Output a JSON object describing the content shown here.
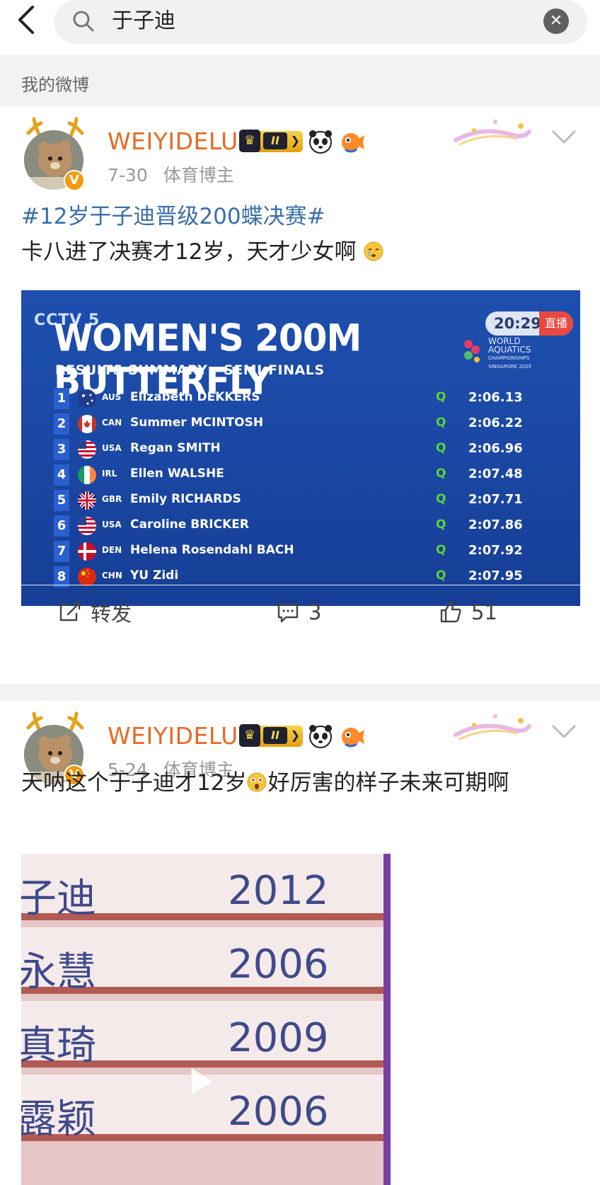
{
  "search": {
    "query": "于子迪"
  },
  "section": {
    "title": "我的微博"
  },
  "posts": [
    {
      "username": "WEIYIDELU",
      "date": "7-30",
      "category": "体育博主",
      "avatar_tag": "出现",
      "topic": "#12岁于子迪晋级200蝶决赛#",
      "text": "卡八进了决赛才12岁，天才少女啊",
      "image": {
        "brand": "CCTV 5",
        "title": "WOMEN'S 200M BUTTERFLY",
        "subtitle": "RESULTS SUMMARY - SEMI-FINALS",
        "clock": "20:29:48",
        "live_label": "直播",
        "event_logo": [
          "WORLD",
          "AQUATICS",
          "CHAMPIONSHIPS",
          "SINGAPORE 2025"
        ],
        "results": [
          {
            "rank": "1",
            "country": "AUS",
            "name": "Elizabeth DEKKERS",
            "q": "Q",
            "time": "2:06.13"
          },
          {
            "rank": "2",
            "country": "CAN",
            "name": "Summer MCINTOSH",
            "q": "Q",
            "time": "2:06.22"
          },
          {
            "rank": "3",
            "country": "USA",
            "name": "Regan SMITH",
            "q": "Q",
            "time": "2:06.96"
          },
          {
            "rank": "4",
            "country": "IRL",
            "name": "Ellen WALSHE",
            "q": "Q",
            "time": "2:07.48"
          },
          {
            "rank": "5",
            "country": "GBR",
            "name": "Emily RICHARDS",
            "q": "Q",
            "time": "2:07.71"
          },
          {
            "rank": "6",
            "country": "USA",
            "name": "Caroline BRICKER",
            "q": "Q",
            "time": "2:07.86"
          },
          {
            "rank": "7",
            "country": "DEN",
            "name": "Helena Rosendahl BACH",
            "q": "Q",
            "time": "2:07.92"
          },
          {
            "rank": "8",
            "country": "CHN",
            "name": "YU Zidi",
            "q": "Q",
            "time": "2:07.95"
          }
        ]
      },
      "actions": {
        "repost": "转发",
        "comments": "3",
        "likes": "51"
      }
    },
    {
      "username": "WEIYIDELU",
      "date": "5-24",
      "category": "体育博主",
      "avatar_tag": "出现",
      "text_a": "天呐这个于子迪才12岁",
      "text_b": "好厉害的样子未来可期啊",
      "image": {
        "rows": [
          {
            "name": "子迪",
            "year": "2012"
          },
          {
            "name": "永慧",
            "year": "2006"
          },
          {
            "name": "真琦",
            "year": "2009"
          },
          {
            "name": "露颖",
            "year": "2006"
          }
        ]
      }
    }
  ],
  "colors": {
    "username": "#e86a22",
    "topic": "#3b6ea8",
    "results_bg": "#1e4fae",
    "qualifier": "#5fd23a"
  },
  "icons": [
    "back-chevron-icon",
    "search-icon",
    "clear-icon",
    "vip-crown-icon",
    "panda-icon",
    "pufferfish-icon",
    "chevron-down-icon",
    "repost-icon",
    "comment-icon",
    "like-icon",
    "play-icon"
  ]
}
